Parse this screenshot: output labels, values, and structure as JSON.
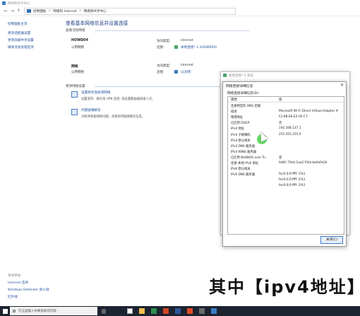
{
  "window": {
    "title": "网络和共享中心"
  },
  "address": {
    "crumbs": [
      "控制面板",
      "网络和 Internet",
      "网络和共享中心"
    ],
    "separator": ">"
  },
  "sidebar": {
    "links": [
      "控制面板主页",
      "更改适配器设置",
      "更改高级共享设置",
      "媒体流式处理选项"
    ],
    "see_also_header": "另请参阅",
    "see_also": [
      "Internet 选项",
      "Windows Defender 防火墙",
      "红外线"
    ]
  },
  "main": {
    "title": "查看基本网络信息并设置连接",
    "active_header": "查看活动网络",
    "networks": [
      {
        "name": "HOWD04",
        "type": "公用网络",
        "access_label": "访问类型:",
        "access": "Internet",
        "conn_label": "连接:",
        "conn": "本地连接* 2 (HOWD04)"
      },
      {
        "name": "网络",
        "type": "公用网络",
        "access_label": "访问类型:",
        "access": "Internet",
        "conn_label": "连接:",
        "conn": "以太网"
      }
    ],
    "change_header": "更改网络设置",
    "tasks": [
      {
        "title": "设置新的连接或网络",
        "desc": "设置宽带、拨号或 VPN 连接; 或设置路由器或接入点。"
      },
      {
        "title": "问题疑难解答",
        "desc": "诊断并修复网络问题，或者获得疑难解答信息。"
      }
    ]
  },
  "status_window": {
    "title": "本地连接* 2 状态"
  },
  "details_dialog": {
    "title": "网络连接详细信息",
    "caption": "网络连接详细信息(D):",
    "col_property": "属性",
    "col_value": "值",
    "rows": [
      {
        "p": "连接特定的 DNS 后缀",
        "v": ""
      },
      {
        "p": "描述",
        "v": "Microsoft Wi-Fi Direct Virtual Adapter #"
      },
      {
        "p": "物理地址",
        "v": "F2-6B-E6-E2-05-C7"
      },
      {
        "p": "已启用 DHCP",
        "v": "否"
      },
      {
        "p": "IPv4 地址",
        "v": "192.168.137.1"
      },
      {
        "p": "IPv4 子网掩码",
        "v": "255.255.255.0"
      },
      {
        "p": "IPv4 默认网关",
        "v": ""
      },
      {
        "p": "IPv4 DNS 服务器",
        "v": ""
      },
      {
        "p": "IPv4 WINS 服务器",
        "v": ""
      },
      {
        "p": "已启用 NetBIOS over Tc...",
        "v": "是"
      },
      {
        "p": "连接-本地 IPv6 地址",
        "v": "fe80::79cb:1aa2:f54a:be6d%18"
      },
      {
        "p": "IPv6 默认网关",
        "v": ""
      },
      {
        "p": "IPv6 DNS 服务器",
        "v": "fec0:0:0:ffff::1%1"
      },
      {
        "p": "",
        "v": "fec0:0:0:ffff::2%1"
      },
      {
        "p": "",
        "v": "fec0:0:0:ffff::3%1"
      }
    ],
    "close_button": "关闭(C)"
  },
  "subtitle": "其中【ipv4地址】",
  "taskbar": {
    "search_placeholder": "在这里输入你要搜索的内容"
  },
  "colors": {
    "link": "#1e4f9c",
    "title": "#1e3f8a",
    "taskbar": "#1c2430",
    "cursor": "#4cd64a"
  }
}
